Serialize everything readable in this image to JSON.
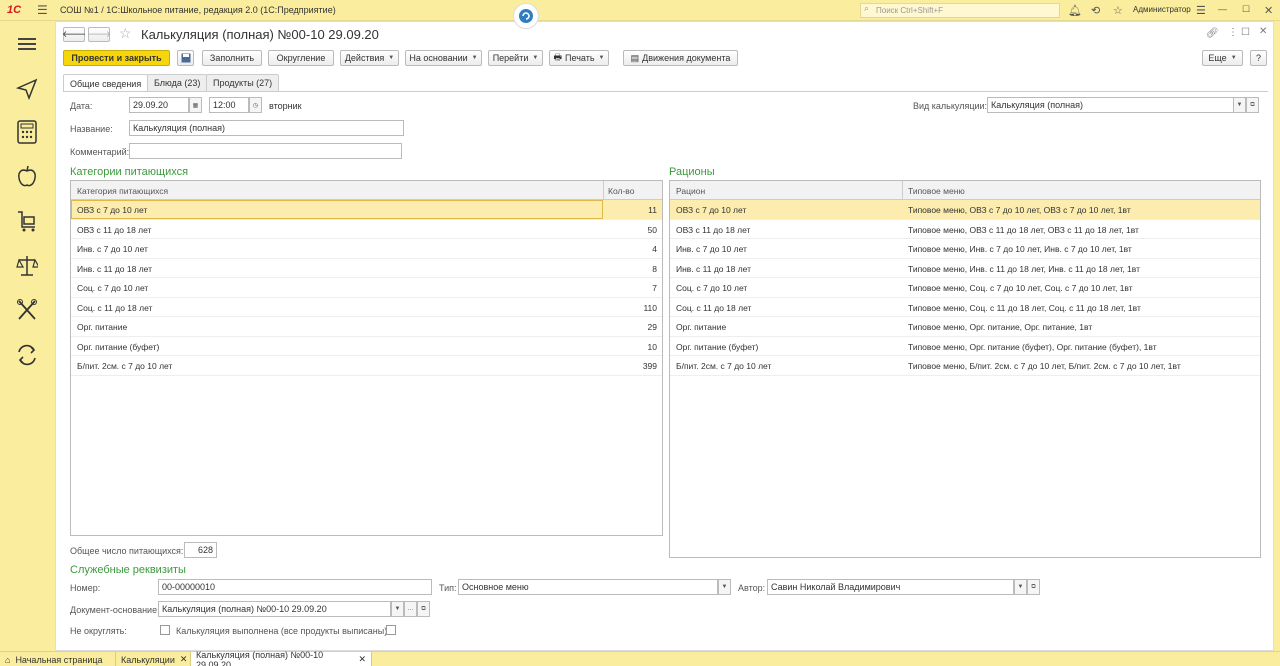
{
  "titlebar": {
    "app_title": "СОШ №1 / 1С:Школьное питание, редакция 2.0  (1С:Предприятие)",
    "search_placeholder": "Поиск Ctrl+Shift+F",
    "user": "Администратор"
  },
  "document": {
    "title": "Калькуляция (полная) №00-10 29.09.20"
  },
  "toolbar": {
    "post_close": "Провести и закрыть",
    "fill": "Заполнить",
    "rounding": "Округление",
    "actions": "Действия",
    "based_on": "На основании",
    "goto": "Перейти",
    "print": "Печать",
    "movements": "Движения документа",
    "more": "Еще",
    "help": "?"
  },
  "tabs": [
    "Общие сведения",
    "Блюда (23)",
    "Продукты (27)"
  ],
  "form": {
    "date_label": "Дата:",
    "date_value": "29.09.20",
    "time_value": "12:00",
    "weekday": "вторник",
    "kind_label": "Вид калькуляции:",
    "kind_value": "Калькуляция (полная)",
    "name_label": "Название:",
    "name_value": "Калькуляция (полная)",
    "comment_label": "Комментарий:",
    "comment_value": ""
  },
  "categories": {
    "title": "Категории питающихся",
    "col_category": "Категория питающихся",
    "col_count": "Кол-во",
    "rows": [
      {
        "name": "ОВЗ с 7 до 10 лет",
        "count": "11"
      },
      {
        "name": "ОВЗ с 11 до 18 лет",
        "count": "50"
      },
      {
        "name": "Инв. с 7 до 10 лет",
        "count": "4"
      },
      {
        "name": "Инв. с 11 до 18 лет",
        "count": "8"
      },
      {
        "name": "Соц. с 7 до 10 лет",
        "count": "7"
      },
      {
        "name": "Соц. с 11 до 18 лет",
        "count": "110"
      },
      {
        "name": "Орг. питание",
        "count": "29"
      },
      {
        "name": "Орг. питание (буфет)",
        "count": "10"
      },
      {
        "name": "Б/пит. 2см. с 7 до 10 лет",
        "count": "399"
      }
    ],
    "total_label": "Общее число питающихся:",
    "total_value": "628"
  },
  "rations": {
    "title": "Рационы",
    "col_ration": "Рацион",
    "col_menu": "Типовое меню",
    "rows": [
      {
        "ration": "ОВЗ с 7 до 10 лет",
        "menu": "Типовое меню, ОВЗ с 7 до 10 лет, ОВЗ с 7 до 10 лет, 1вт"
      },
      {
        "ration": "ОВЗ с 11 до 18 лет",
        "menu": "Типовое меню, ОВЗ с 11 до 18 лет, ОВЗ с 11 до 18 лет, 1вт"
      },
      {
        "ration": "Инв. с 7 до 10 лет",
        "menu": "Типовое меню, Инв. с 7 до 10 лет, Инв. с 7 до 10 лет, 1вт"
      },
      {
        "ration": "Инв. с 11 до 18 лет",
        "menu": "Типовое меню, Инв. с 11 до 18 лет, Инв. с 11 до 18 лет, 1вт"
      },
      {
        "ration": "Соц. с 7 до 10 лет",
        "menu": "Типовое меню, Соц. с 7 до 10 лет, Соц. с 7 до 10 лет, 1вт"
      },
      {
        "ration": "Соц. с 11 до 18 лет",
        "menu": "Типовое меню, Соц. с 11 до 18 лет, Соц. с 11 до 18 лет, 1вт"
      },
      {
        "ration": "Орг. питание",
        "menu": "Типовое меню, Орг. питание, Орг. питание, 1вт"
      },
      {
        "ration": "Орг. питание (буфет)",
        "menu": "Типовое меню, Орг. питание (буфет), Орг. питание (буфет), 1вт"
      },
      {
        "ration": "Б/пит. 2см. с 7 до 10 лет",
        "menu": "Типовое меню, Б/пит. 2см. с 7 до 10 лет, Б/пит. 2см. с 7 до 10 лет, 1вт"
      }
    ]
  },
  "service": {
    "title": "Служебные реквизиты",
    "number_label": "Номер:",
    "number_value": "00-00000010",
    "type_label": "Тип:",
    "type_value": "Основное меню",
    "author_label": "Автор:",
    "author_value": "Савин Николай Владимирович",
    "basis_label": "Документ-основание:",
    "basis_value": "Калькуляция (полная) №00-10 29.09.20",
    "no_round_label": "Не округлять:",
    "done_label": "Калькуляция выполнена (все продукты выписаны):"
  },
  "bottom_tabs": [
    "Начальная страница",
    "Калькуляции",
    "Калькуляция (полная) №00-10 29.09.20"
  ]
}
